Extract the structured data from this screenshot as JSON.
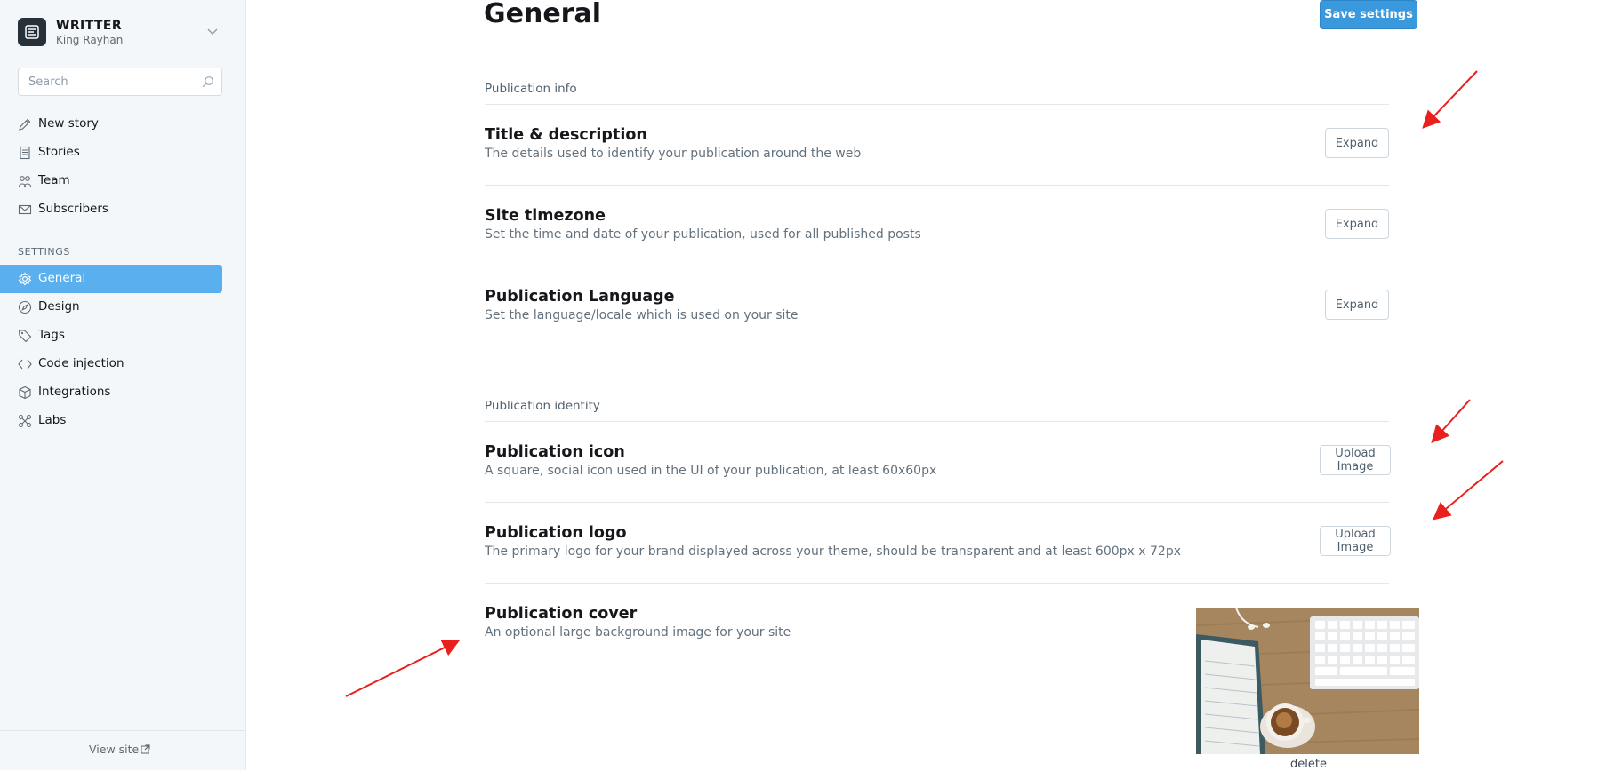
{
  "brand": {
    "name": "WRITTER",
    "user": "King Rayhan"
  },
  "search": {
    "placeholder": "Search"
  },
  "nav": {
    "primary": [
      {
        "label": "New story",
        "icon": "pencil-icon"
      },
      {
        "label": "Stories",
        "icon": "document-icon"
      },
      {
        "label": "Team",
        "icon": "team-icon"
      },
      {
        "label": "Subscribers",
        "icon": "envelope-icon"
      }
    ],
    "settings_label": "SETTINGS",
    "settings": [
      {
        "label": "General",
        "icon": "gear-icon",
        "active": true
      },
      {
        "label": "Design",
        "icon": "compass-icon"
      },
      {
        "label": "Tags",
        "icon": "tag-icon"
      },
      {
        "label": "Code injection",
        "icon": "code-icon"
      },
      {
        "label": "Integrations",
        "icon": "cube-icon"
      },
      {
        "label": "Labs",
        "icon": "labs-icon"
      }
    ]
  },
  "footer": {
    "view_site": "View site"
  },
  "main": {
    "title": "General",
    "save_label": "Save settings",
    "groups": [
      {
        "label": "Publication info",
        "rows": [
          {
            "title": "Title & description",
            "desc": "The details used to identify your publication around the web",
            "action": "Expand"
          },
          {
            "title": "Site timezone",
            "desc": "Set the time and date of your publication, used for all published posts",
            "action": "Expand"
          },
          {
            "title": "Publication Language",
            "desc": "Set the language/locale which is used on your site",
            "action": "Expand"
          }
        ]
      },
      {
        "label": "Publication identity",
        "rows": [
          {
            "title": "Publication icon",
            "desc": "A square, social icon used in the UI of your publication, at least 60x60px",
            "action": "Upload Image"
          },
          {
            "title": "Publication logo",
            "desc": "The primary logo for your brand displayed across your theme, should be transparent and at least 600px x 72px",
            "action": "Upload Image"
          },
          {
            "title": "Publication cover",
            "desc": "An optional large background image for your site",
            "action": "delete"
          }
        ]
      }
    ]
  },
  "colors": {
    "accent": "#5ab0ee",
    "save_button": "#3a98dd",
    "annotation_arrow": "#e8201e"
  }
}
